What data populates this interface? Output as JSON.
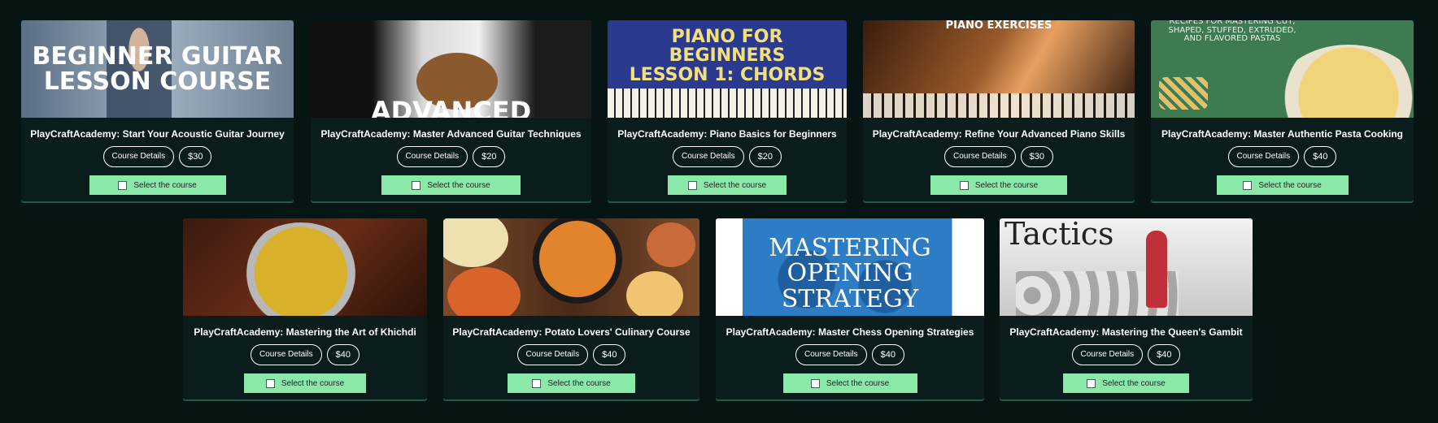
{
  "courses_row1": [
    {
      "title": "PlayCraftAcademy: Start Your Acoustic Guitar Journey",
      "details_label": "Course Details",
      "price": "$30",
      "select_label": "Select the course",
      "thumb_text": "BEGINNER GUITAR\nLESSON COURSE"
    },
    {
      "title": "PlayCraftAcademy: Master Advanced Guitar Techniques",
      "details_label": "Course Details",
      "price": "$20",
      "select_label": "Select the course",
      "thumb_text": "ADVANCED"
    },
    {
      "title": "PlayCraftAcademy: Piano Basics for Beginners",
      "details_label": "Course Details",
      "price": "$20",
      "select_label": "Select the course",
      "thumb_text": "PIANO FOR\nBEGINNERS\nLESSON 1: CHORDS"
    },
    {
      "title": "PlayCraftAcademy: Refine Your Advanced Piano Skills",
      "details_label": "Course Details",
      "price": "$30",
      "select_label": "Select the course",
      "thumb_text": "PIANO EXERCISES"
    },
    {
      "title": "PlayCraftAcademy: Master Authentic Pasta Cooking",
      "details_label": "Course Details",
      "price": "$40",
      "select_label": "Select the course",
      "thumb_text": "RECIPES FOR MASTERING CUT,\nSHAPED, STUFFED, EXTRUDED,\nAND FLAVORED PASTAS"
    }
  ],
  "courses_row2": [
    {
      "title": "PlayCraftAcademy: Mastering the Art of Khichdi",
      "details_label": "Course Details",
      "price": "$40",
      "select_label": "Select the course",
      "thumb_text": ""
    },
    {
      "title": "PlayCraftAcademy: Potato Lovers' Culinary Course",
      "details_label": "Course Details",
      "price": "$40",
      "select_label": "Select the course",
      "thumb_text": ""
    },
    {
      "title": "PlayCraftAcademy: Master Chess Opening Strategies",
      "details_label": "Course Details",
      "price": "$40",
      "select_label": "Select the course",
      "thumb_text": "MASTERING\nOPENING\nSTRATEGY"
    },
    {
      "title": "PlayCraftAcademy: Mastering the Queen's Gambit",
      "details_label": "Course Details",
      "price": "$40",
      "select_label": "Select the course",
      "thumb_text": "Tactics"
    }
  ]
}
